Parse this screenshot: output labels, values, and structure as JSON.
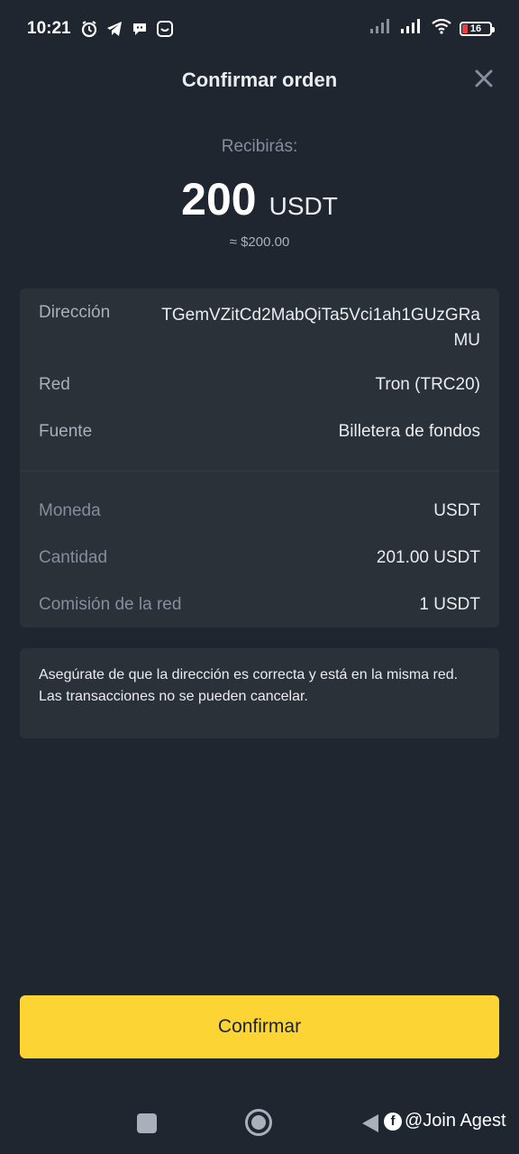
{
  "status_bar": {
    "time": "10:21",
    "battery": "16",
    "icons": [
      "alarm-icon",
      "telegram-icon",
      "chat-icon",
      "app-icon",
      "signal-icon",
      "signal-icon",
      "wifi-icon",
      "battery-icon"
    ]
  },
  "header": {
    "title": "Confirmar orden",
    "close_icon": "close-icon"
  },
  "summary": {
    "label": "Recibirás:",
    "amount": "200",
    "unit": "USDT",
    "fiat": "≈ $200.00"
  },
  "details": {
    "address": {
      "label": "Dirección",
      "value": "TGemVZitCd2MabQiTa5Vci1ah1GUzGRaMU"
    },
    "network": {
      "label": "Red",
      "value": "Tron (TRC20)"
    },
    "source": {
      "label": "Fuente",
      "value": "Billetera de fondos"
    },
    "coin": {
      "label": "Moneda",
      "value": "USDT"
    },
    "quantity": {
      "label": "Cantidad",
      "value": "201.00 USDT"
    },
    "fee": {
      "label": "Comisión de la red",
      "value": "1 USDT"
    }
  },
  "warning": {
    "line1": "Asegúrate de que la dirección es correcta y está en la misma red.",
    "line2": "Las transacciones no se pueden cancelar."
  },
  "confirm": {
    "label": "Confirmar"
  },
  "watermark": {
    "fb_letter": "f",
    "text": "@Join Agest"
  },
  "colors": {
    "background": "#1f2630",
    "card": "#2b3139",
    "accent": "#fcd535",
    "muted_text": "#848e9c"
  }
}
